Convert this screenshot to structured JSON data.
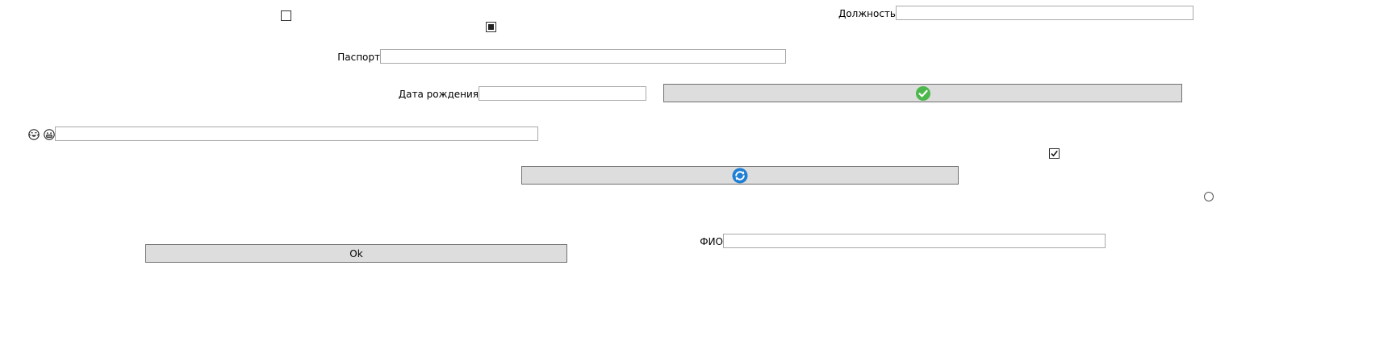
{
  "form": {
    "position_label": "Должность",
    "position_value": "",
    "passport_label": "Паспорт",
    "passport_value": "",
    "birthdate_label": "Дата рождения",
    "birthdate_value": "",
    "emoji_field_value": "",
    "fio_label": "ФИО",
    "fio_value": ""
  },
  "buttons": {
    "confirm_icon": "green-checkmark-icon",
    "refresh_icon": "blue-refresh-icon",
    "ok_label": "Ok"
  },
  "controls": {
    "checkbox_top": {
      "checked": false
    },
    "checkbox_middle": {
      "state": "indeterminate"
    },
    "checkbox_right": {
      "checked": true
    },
    "radio_right": {
      "checked": false
    }
  },
  "icons": {
    "emoji_one": "laughing-tears-face-icon",
    "emoji_two": "grinning-face-icon"
  },
  "colors": {
    "button_bg": "#dddddd",
    "confirm_green": "#4cb84c",
    "refresh_blue": "#1e7fd4"
  }
}
